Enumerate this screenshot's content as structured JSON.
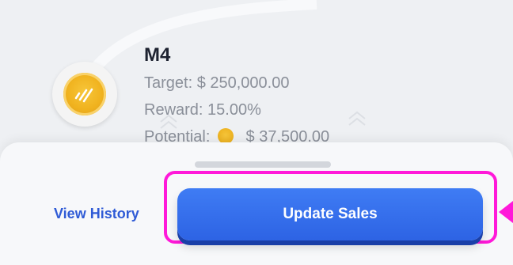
{
  "tier": {
    "name": "M4",
    "target": "Target: $ 250,000.00",
    "reward": "Reward: 15.00%",
    "potential_label": "Potential:",
    "potential_value": "$ 37,500.00"
  },
  "actions": {
    "view_history": "View History",
    "update_sales": "Update Sales"
  },
  "colors": {
    "accent_blue": "#2d63e4",
    "highlight_magenta": "#ff19d9",
    "coin_gold": "#f0b21e"
  }
}
